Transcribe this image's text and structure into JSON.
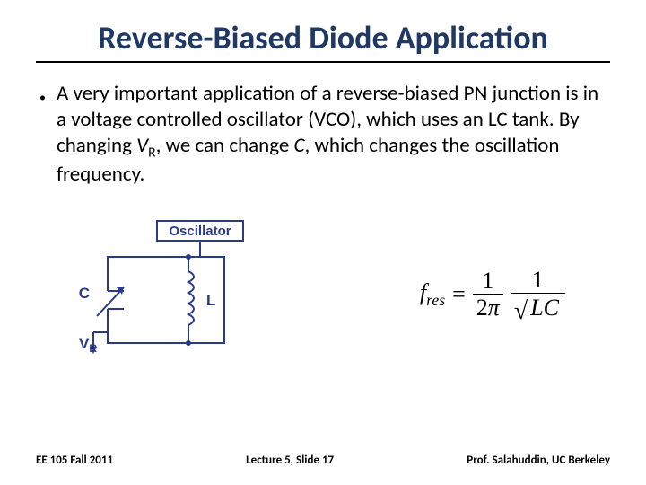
{
  "title": "Reverse-Biased Diode Application",
  "bullet": {
    "pre": "A very important application of a reverse-biased PN junction is in a voltage controlled oscillator (VCO), which uses an LC tank.  By changing ",
    "vr": "V",
    "vr_sub": "R",
    "mid": ", we can change ",
    "c": "C",
    "post": ", which changes the oscillation frequency."
  },
  "circuit": {
    "label": "Oscillator",
    "c": "C",
    "l": "L",
    "vr": "V",
    "vr_sub": "R"
  },
  "formula": {
    "lhs_var": "f",
    "lhs_sub": "res",
    "eq": "=",
    "num1": "1",
    "den1_2": "2",
    "den1_pi": "π",
    "num2": "1",
    "sqrt_body": "LC"
  },
  "footer": {
    "left": "EE 105 Fall 2011",
    "center": "Lecture 5, Slide 17",
    "right": "Prof. Salahuddin, UC Berkeley"
  }
}
